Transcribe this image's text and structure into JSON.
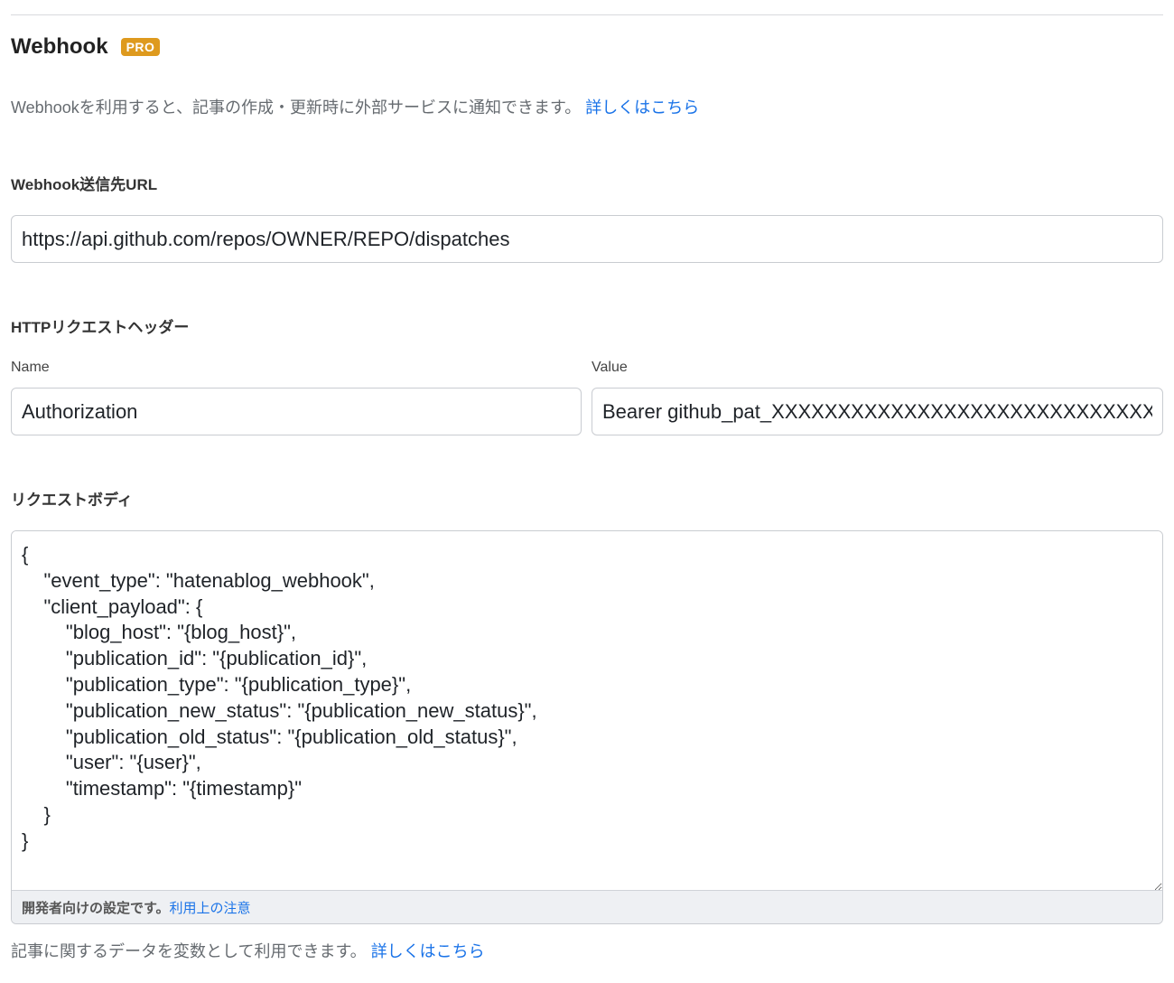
{
  "section": {
    "title": "Webhook",
    "badge": "PRO",
    "description": "Webhookを利用すると、記事の作成・更新時に外部サービスに通知できます。",
    "description_link": "詳しくはこちら"
  },
  "url_field": {
    "label": "Webhook送信先URL",
    "value": "https://api.github.com/repos/OWNER/REPO/dispatches"
  },
  "headers": {
    "label": "HTTPリクエストヘッダー",
    "name_label": "Name",
    "name_value": "Authorization",
    "value_label": "Value",
    "value_value": "Bearer github_pat_XXXXXXXXXXXXXXXXXXXXXXXXXXXXXXXX"
  },
  "body": {
    "label": "リクエストボディ",
    "value": "{\n    \"event_type\": \"hatenablog_webhook\",\n    \"client_payload\": {\n        \"blog_host\": \"{blog_host}\",\n        \"publication_id\": \"{publication_id}\",\n        \"publication_type\": \"{publication_type}\",\n        \"publication_new_status\": \"{publication_new_status}\",\n        \"publication_old_status\": \"{publication_old_status}\",\n        \"user\": \"{user}\",\n        \"timestamp\": \"{timestamp}\"\n    }\n}",
    "footer_note": "開発者向けの設定です。",
    "footer_link": "利用上の注意"
  },
  "bottom": {
    "text": "記事に関するデータを変数として利用できます。",
    "link": "詳しくはこちら"
  }
}
